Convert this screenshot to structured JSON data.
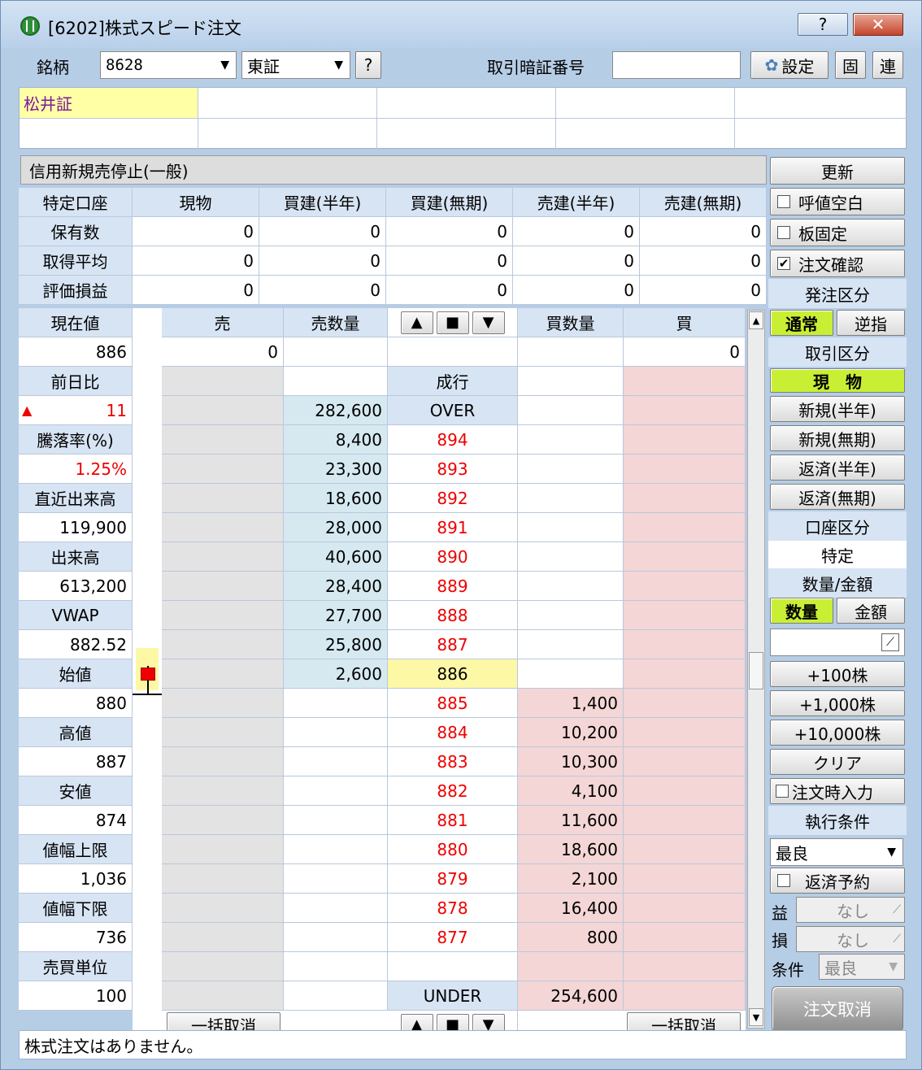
{
  "window": {
    "title": "[6202]株式スピード注文",
    "help_label": "?",
    "close_label": "✕"
  },
  "toolbar": {
    "symbol_label": "銘柄",
    "symbol_value": "8628",
    "market_value": "東証",
    "help_label": "?",
    "pin_label": "取引暗証番号",
    "pin_value": "",
    "settings_label": "設定",
    "fixed_label": "固",
    "link_label": "連"
  },
  "stock_name": "松井証",
  "restriction_text": "信用新規売停止(一般)",
  "update_label": "更新",
  "holdings": {
    "corner": "特定口座",
    "columns": [
      "現物",
      "買建(半年)",
      "買建(無期)",
      "売建(半年)",
      "売建(無期)"
    ],
    "rows": [
      {
        "label": "保有数",
        "values": [
          "0",
          "0",
          "0",
          "0",
          "0"
        ]
      },
      {
        "label": "取得平均",
        "values": [
          "0",
          "0",
          "0",
          "0",
          "0"
        ]
      },
      {
        "label": "評価損益",
        "values": [
          "0",
          "0",
          "0",
          "0",
          "0"
        ]
      }
    ]
  },
  "quote": [
    {
      "label": "現在値",
      "value": "886"
    },
    {
      "label": "前日比",
      "value": "11",
      "prefix": "▲"
    },
    {
      "label": "騰落率(%)",
      "value": "1.25%"
    },
    {
      "label": "直近出来高",
      "value": "119,900"
    },
    {
      "label": "出来高",
      "value": "613,200"
    },
    {
      "label": "VWAP",
      "value": "882.52"
    },
    {
      "label": "始値",
      "value": "880"
    },
    {
      "label": "高値",
      "value": "887"
    },
    {
      "label": "安値",
      "value": "874"
    },
    {
      "label": "値幅上限",
      "value": "1,036"
    },
    {
      "label": "値幅下限",
      "value": "736"
    },
    {
      "label": "売買単位",
      "value": "100"
    }
  ],
  "board": {
    "headers": {
      "sell": "売",
      "sell_qty": "売数量",
      "buy_qty": "買数量",
      "buy": "買"
    },
    "sell_order": "0",
    "buy_order": "0",
    "market_label": "成行",
    "over_label": "OVER",
    "over_qty": "282,600",
    "under_label": "UNDER",
    "under_qty": "254,600",
    "asks": [
      {
        "price": "894",
        "qty": "8,400"
      },
      {
        "price": "893",
        "qty": "23,300"
      },
      {
        "price": "892",
        "qty": "18,600"
      },
      {
        "price": "891",
        "qty": "28,000"
      },
      {
        "price": "890",
        "qty": "40,600"
      },
      {
        "price": "889",
        "qty": "28,400"
      },
      {
        "price": "888",
        "qty": "27,700"
      },
      {
        "price": "887",
        "qty": "25,800"
      },
      {
        "price": "886",
        "qty": "2,600"
      }
    ],
    "bids": [
      {
        "price": "885",
        "qty": "1,400"
      },
      {
        "price": "884",
        "qty": "10,200"
      },
      {
        "price": "883",
        "qty": "10,300"
      },
      {
        "price": "882",
        "qty": "4,100"
      },
      {
        "price": "881",
        "qty": "11,600"
      },
      {
        "price": "880",
        "qty": "18,600"
      },
      {
        "price": "879",
        "qty": "2,100"
      },
      {
        "price": "878",
        "qty": "16,400"
      },
      {
        "price": "877",
        "qty": "800"
      }
    ],
    "cancel_all_label": "一括取消"
  },
  "right_panel": {
    "tick_blank_label": "呼値空白",
    "board_fix_label": "板固定",
    "confirm_label": "注文確認",
    "confirm_checked": "✔",
    "order_type_header": "発注区分",
    "normal_label": "通常",
    "reverse_label": "逆指",
    "trade_type_header": "取引区分",
    "cash_label": "現　物",
    "new6m_label": "新規(半年)",
    "newinf_label": "新規(無期)",
    "repay6m_label": "返済(半年)",
    "repayinf_label": "返済(無期)",
    "account_header": "口座区分",
    "account_value": "特定",
    "qty_amount_header": "数量/金額",
    "qty_label": "数量",
    "amount_label": "金額",
    "add100_label": "+100株",
    "add1000_label": "+1,000株",
    "add10000_label": "+10,000株",
    "clear_label": "クリア",
    "input_on_order_label": "注文時入力",
    "exec_header": "執行条件",
    "exec_value": "最良",
    "repay_reserve_label": "返済予約",
    "profit_label": "益",
    "profit_value": "なし",
    "loss_label": "損",
    "loss_value": "なし",
    "cond_label": "条件",
    "cond_value": "最良",
    "cancel_order_label": "注文取消"
  },
  "status_text": "株式注文はありません。",
  "colors": {
    "window_bg": "#b6cde6",
    "header_bg": "#d7e4f3",
    "ask_bg": "#d6e9f1",
    "bid_bg": "#f4d6d6",
    "current_price_bg": "#fdf8a6",
    "active_green": "#c9ef35",
    "up_red": "#e00000"
  }
}
